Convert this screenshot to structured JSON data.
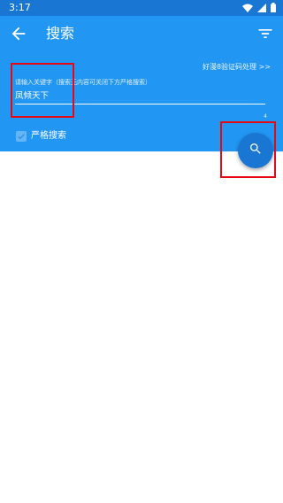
{
  "statusbar": {
    "time": "3:17",
    "icons": [
      "wifi-icon",
      "signal-icon",
      "battery-icon"
    ]
  },
  "appbar": {
    "title": "搜索",
    "back_icon": "arrow-back-icon",
    "filter_icon": "filter-icon"
  },
  "search": {
    "captcha_link": "好漫8验证码处理 >>",
    "input_label": "请输入关键字（搜索无内容可关闭下方严格搜索）",
    "input_value": "凤倾天下",
    "char_count": "4",
    "strict_label": "严格搜索",
    "strict_checked": true
  },
  "fab": {
    "icon": "search-icon"
  },
  "colors": {
    "primary": "#2196f3",
    "primary_dark": "#1976d2",
    "highlight": "#e50914"
  }
}
